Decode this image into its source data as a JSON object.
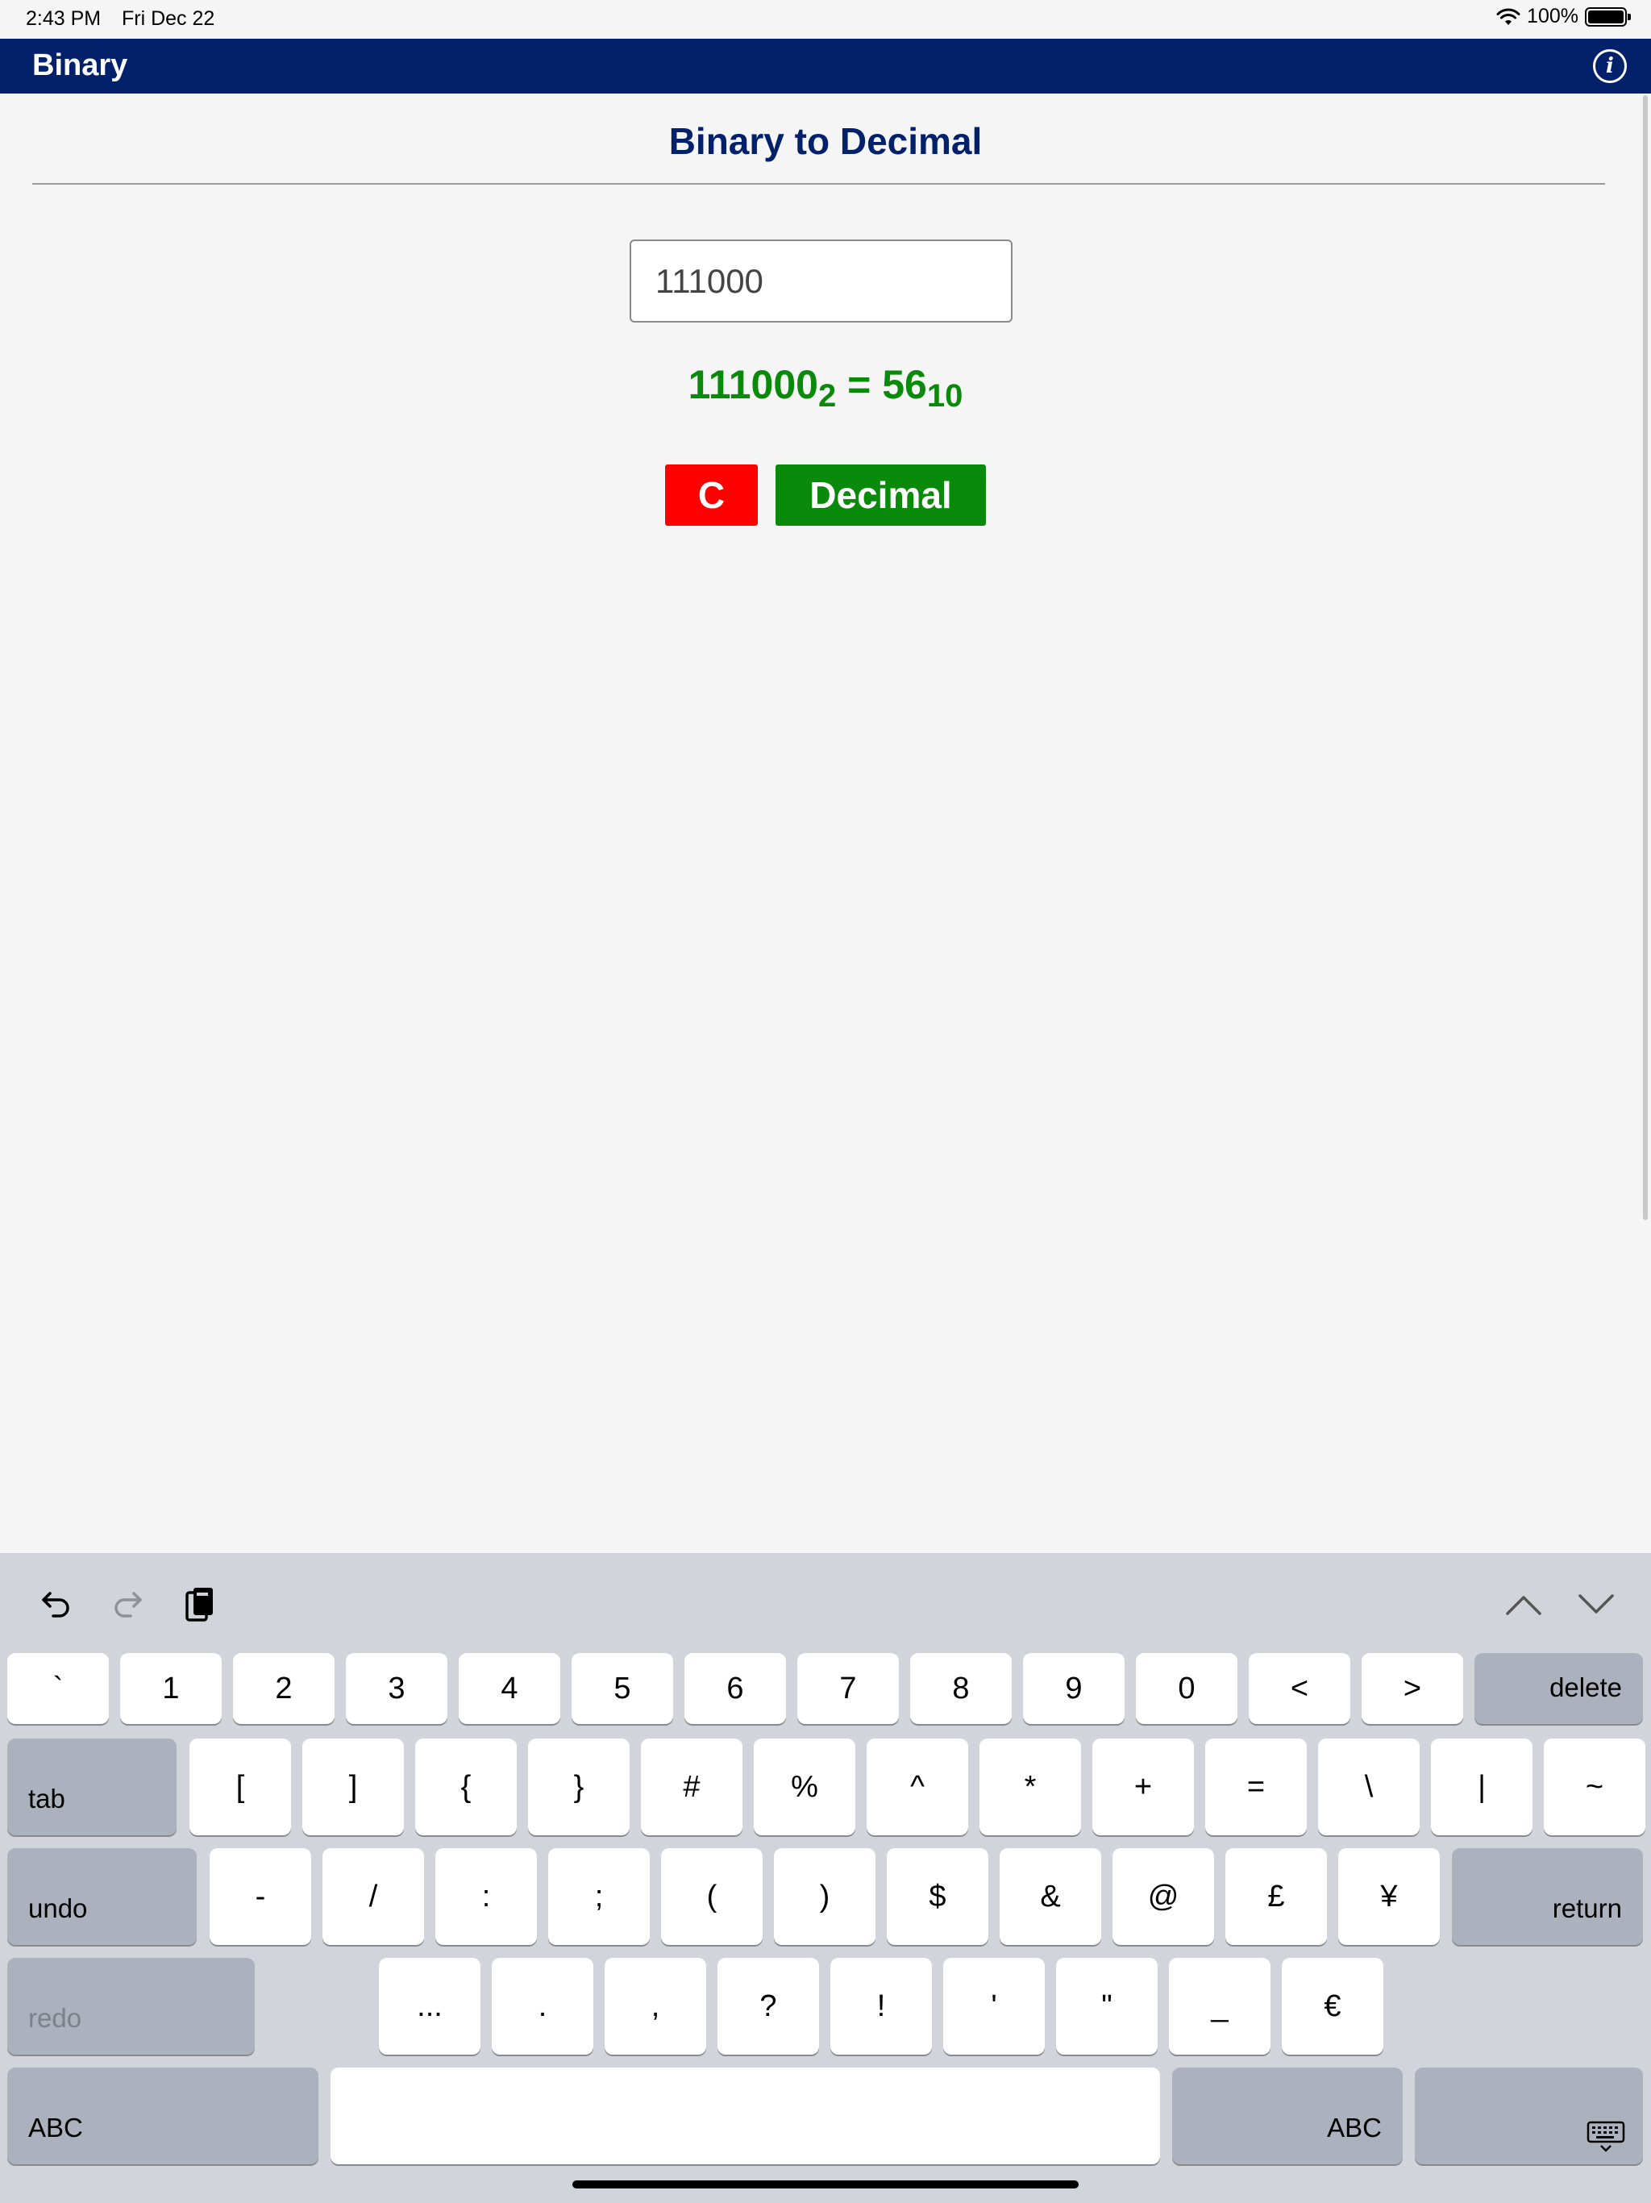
{
  "status_bar": {
    "time": "2:43 PM",
    "date": "Fri Dec 22",
    "battery": "100%"
  },
  "navbar": {
    "title": "Binary",
    "info_icon": "info-icon",
    "info_label": "i"
  },
  "page": {
    "heading": "Binary to Decimal",
    "input_value": "111000",
    "result": {
      "binary": "111000",
      "binary_base": "2",
      "equals": " = ",
      "decimal": "56",
      "decimal_base": "10"
    },
    "clear_label": "C",
    "convert_label": "Decimal"
  },
  "colors": {
    "navbar": "#03216b",
    "heading": "#03216b",
    "result": "#0a8a0a",
    "clear_button": "#ff0000",
    "convert_button": "#0a8a0a"
  },
  "keyboard": {
    "toolbar": {
      "undo_icon": "undo-icon",
      "redo_icon": "redo-icon",
      "paste_icon": "paste-icon",
      "up_icon": "chevron-up-icon",
      "down_icon": "chevron-down-icon"
    },
    "row1": [
      "`",
      "1",
      "2",
      "3",
      "4",
      "5",
      "6",
      "7",
      "8",
      "9",
      "0",
      "<",
      ">"
    ],
    "delete": "delete",
    "tab": "tab",
    "row2": [
      "[",
      "]",
      "{",
      "}",
      "#",
      "%",
      "^",
      "*",
      "+",
      "=",
      "\\",
      "|",
      "~"
    ],
    "undo": "undo",
    "row3": [
      "-",
      "/",
      ":",
      ";",
      "(",
      ")",
      "$",
      "&",
      "@",
      "£",
      "¥"
    ],
    "return": "return",
    "redo": "redo",
    "row4": [
      "...",
      ".",
      ",",
      "?",
      "!",
      "'",
      "\"",
      "_",
      "€"
    ],
    "abc_left": "ABC",
    "abc_right": "ABC",
    "dismiss_icon": "keyboard-dismiss-icon"
  }
}
